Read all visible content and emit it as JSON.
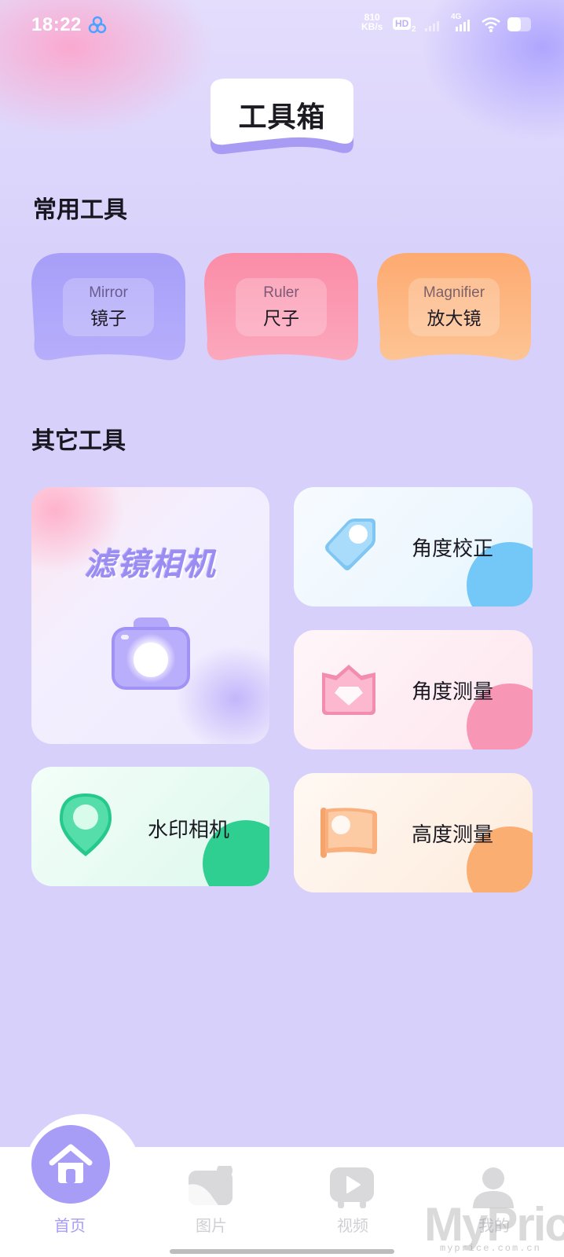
{
  "status_bar": {
    "time": "18:22",
    "net_speed_value": "810",
    "net_speed_unit": "KB/s",
    "hd_label": "HD",
    "hd_sub": "2",
    "network_type": "4G"
  },
  "header": {
    "title": "工具箱"
  },
  "common_tools": {
    "section_title": "常用工具",
    "items": [
      {
        "en": "Mirror",
        "zh": "镜子",
        "color": "#a39bf6"
      },
      {
        "en": "Ruler",
        "zh": "尺子",
        "color": "#fb8ea9"
      },
      {
        "en": "Magnifier",
        "zh": "放大镜",
        "color": "#fdab72"
      }
    ]
  },
  "other_tools": {
    "section_title": "其它工具",
    "filter_camera": {
      "label": "滤镜相机"
    },
    "angle_correct": {
      "label": "角度校正",
      "accent": "#6fc6f6"
    },
    "angle_measure": {
      "label": "角度测量",
      "accent": "#f894b3"
    },
    "watermark_camera": {
      "label": "水印相机",
      "accent": "#22c98c"
    },
    "height_measure": {
      "label": "高度测量",
      "accent": "#fbad70"
    }
  },
  "bottom_nav": {
    "items": [
      {
        "label": "首页",
        "icon": "home-icon",
        "active": true
      },
      {
        "label": "图片",
        "icon": "image-icon",
        "active": false
      },
      {
        "label": "视频",
        "icon": "video-icon",
        "active": false
      },
      {
        "label": "我的",
        "icon": "profile-icon",
        "active": false
      }
    ]
  },
  "watermark": {
    "brand": "MyPrice",
    "url": "myprice.com.cn"
  },
  "colors": {
    "background": "#d6d0fb",
    "accent": "#a79cf6"
  }
}
